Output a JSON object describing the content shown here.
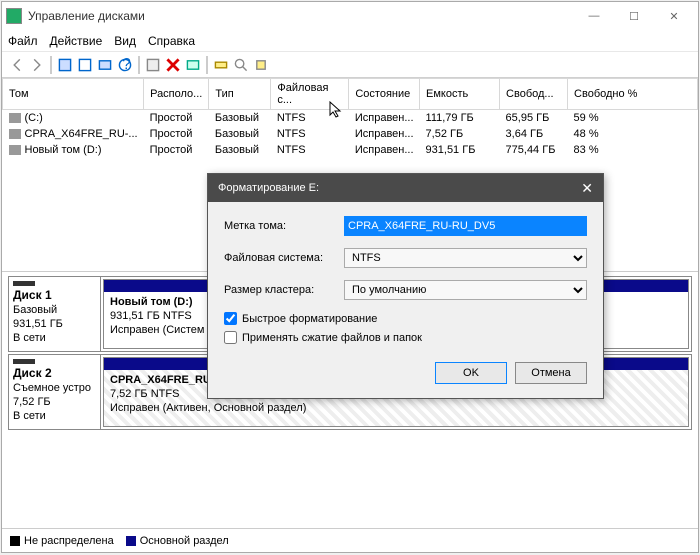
{
  "window": {
    "title": "Управление дисками",
    "min": "—",
    "max": "☐",
    "close": "✕"
  },
  "menu": {
    "file": "Файл",
    "action": "Действие",
    "view": "Вид",
    "help": "Справка"
  },
  "columns": {
    "volume": "Том",
    "layout": "Располо...",
    "type": "Тип",
    "fs": "Файловая с...",
    "status": "Состояние",
    "capacity": "Емкость",
    "free": "Свобод...",
    "freepct": "Свободно %"
  },
  "volumes": [
    {
      "name": "(C:)",
      "layout": "Простой",
      "type": "Базовый",
      "fs": "NTFS",
      "status": "Исправен...",
      "capacity": "111,79 ГБ",
      "free": "65,95 ГБ",
      "freepct": "59 %"
    },
    {
      "name": "CPRA_X64FRE_RU-...",
      "layout": "Простой",
      "type": "Базовый",
      "fs": "NTFS",
      "status": "Исправен...",
      "capacity": "7,52 ГБ",
      "free": "3,64 ГБ",
      "freepct": "48 %"
    },
    {
      "name": "Новый том (D:)",
      "layout": "Простой",
      "type": "Базовый",
      "fs": "NTFS",
      "status": "Исправен...",
      "capacity": "931,51 ГБ",
      "free": "775,44 ГБ",
      "freepct": "83 %"
    }
  ],
  "disks": [
    {
      "label": "Диск 1",
      "type": "Базовый",
      "size": "931,51 ГБ",
      "state": "В сети",
      "part": {
        "name": "Новый том  (D:)",
        "fs": "931,51 ГБ NTFS",
        "status": "Исправен (Систем"
      }
    },
    {
      "label": "Диск 2",
      "type": "Съемное устро",
      "size": "7,52 ГБ",
      "state": "В сети",
      "part": {
        "name": "CPRA_X64FRE_RU-RU_DV5  (E:)",
        "fs": "7,52 ГБ NTFS",
        "status": "Исправен (Активен, Основной раздел)"
      }
    }
  ],
  "legend": {
    "unalloc": "Не распределена",
    "primary": "Основной раздел"
  },
  "dialog": {
    "title": "Форматирование E:",
    "label_volume": "Метка тома:",
    "label_fs": "Файловая система:",
    "label_cluster": "Размер кластера:",
    "value_volume": "CPRA_X64FRE_RU-RU_DV5",
    "value_fs": "NTFS",
    "value_cluster": "По умолчанию",
    "quick": "Быстрое форматирование",
    "compress": "Применять сжатие файлов и папок",
    "ok": "OK",
    "cancel": "Отмена"
  }
}
